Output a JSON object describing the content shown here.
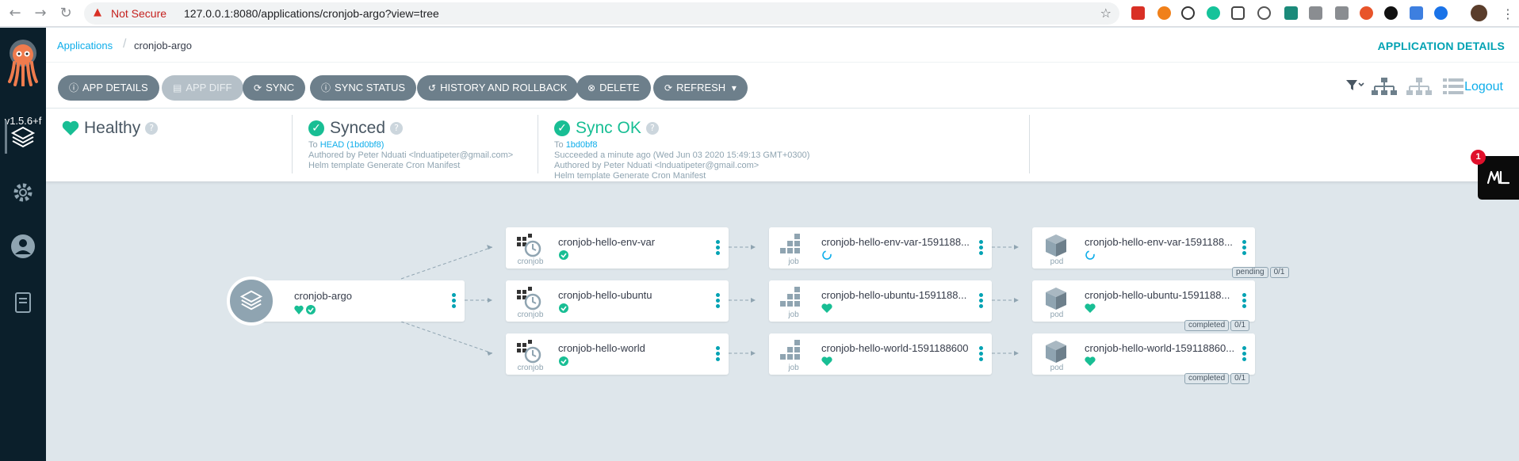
{
  "browser": {
    "not_secure": "Not Secure",
    "url": "127.0.0.1:8080/applications/cronjob-argo?view=tree"
  },
  "rail": {
    "version": "v1.5.6+f"
  },
  "header": {
    "breadcrumb_root": "Applications",
    "breadcrumb_current": "cronjob-argo",
    "page_title": "APPLICATION DETAILS"
  },
  "toolbar": {
    "buttons": [
      "APP DETAILS",
      "APP DIFF",
      "SYNC",
      "SYNC STATUS",
      "HISTORY AND ROLLBACK",
      "DELETE",
      "REFRESH"
    ],
    "logout": "Logout"
  },
  "status": {
    "health": {
      "title": "Healthy"
    },
    "sync": {
      "title": "Synced",
      "to_prefix": "To",
      "revision": "HEAD (1bd0bf8)",
      "author": "Authored by Peter Nduati <lnduatipeter@gmail.com>",
      "message": "Helm template Generate Cron Manifest"
    },
    "operation": {
      "title": "Sync OK",
      "to_prefix": "To",
      "revision": "1bd0bf8",
      "when": "Succeeded a minute ago (Wed Jun 03 2020 15:49:13 GMT+0300)",
      "author": "Authored by Peter Nduati <lnduatipeter@gmail.com>",
      "message": "Helm template Generate Cron Manifest"
    }
  },
  "widget": {
    "badge": "1"
  },
  "tree": {
    "app": {
      "name": "cronjob-argo"
    },
    "cronjobs": [
      {
        "name": "cronjob-hello-env-var",
        "kind": "cronjob"
      },
      {
        "name": "cronjob-hello-ubuntu",
        "kind": "cronjob"
      },
      {
        "name": "cronjob-hello-world",
        "kind": "cronjob"
      }
    ],
    "jobs": [
      {
        "name": "cronjob-hello-env-var-1591188...",
        "kind": "job"
      },
      {
        "name": "cronjob-hello-ubuntu-1591188...",
        "kind": "job"
      },
      {
        "name": "cronjob-hello-world-1591188600",
        "kind": "job"
      }
    ],
    "pods": [
      {
        "name": "cronjob-hello-env-var-1591188...",
        "kind": "pod",
        "tag_status": "pending",
        "tag_ready": "0/1"
      },
      {
        "name": "cronjob-hello-ubuntu-1591188...",
        "kind": "pod",
        "tag_status": "completed",
        "tag_ready": "0/1"
      },
      {
        "name": "cronjob-hello-world-159118860...",
        "kind": "pod",
        "tag_status": "completed",
        "tag_ready": "0/1"
      }
    ]
  },
  "colors": {
    "teal": "#18be94",
    "accent": "#00a2b3",
    "link": "#0dadea",
    "rail": "#0b1f2b",
    "button": "#6d7f8b"
  }
}
